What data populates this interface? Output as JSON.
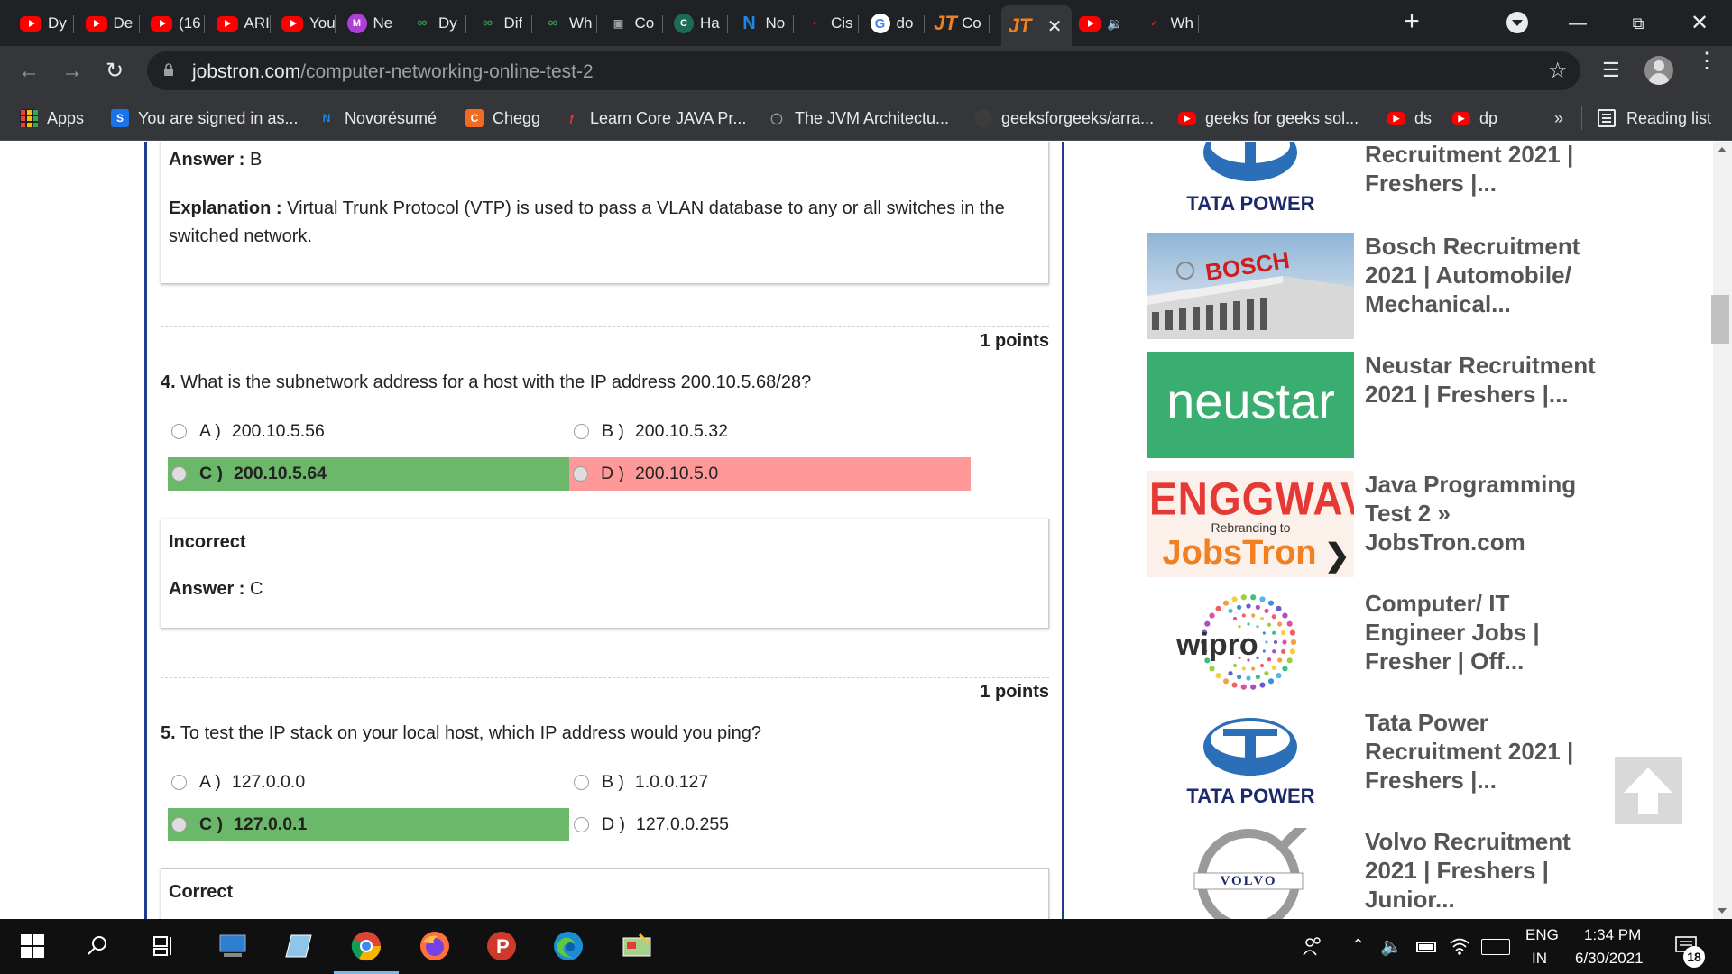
{
  "browser": {
    "tabs": [
      {
        "title": "Dy",
        "icon": "youtube-icon"
      },
      {
        "title": "De",
        "icon": "youtube-icon"
      },
      {
        "title": "(16",
        "icon": "youtube-icon"
      },
      {
        "title": "ARI",
        "icon": "youtube-icon"
      },
      {
        "title": "You",
        "icon": "youtube-icon"
      },
      {
        "title": "Ne",
        "icon": "messenger-icon"
      },
      {
        "title": "Dy",
        "icon": "geeksforgeeks-icon"
      },
      {
        "title": "Dif",
        "icon": "geeksforgeeks-icon"
      },
      {
        "title": "Wh",
        "icon": "geeksforgeeks-icon"
      },
      {
        "title": "Co",
        "icon": "coursera-icon"
      },
      {
        "title": "Ha",
        "icon": "c-icon"
      },
      {
        "title": "No",
        "icon": "novoresume-icon"
      },
      {
        "title": "Cis",
        "icon": "cisco-icon"
      },
      {
        "title": "do",
        "icon": "google-icon"
      },
      {
        "title": "Co",
        "icon": "jobstron-icon"
      },
      {
        "title": "",
        "icon": "jobstron-icon",
        "active": true
      },
      {
        "title": "",
        "icon": "youtube-icon",
        "audio": true
      },
      {
        "title": "Wh",
        "icon": "tutorial-icon"
      }
    ],
    "url_domain": "jobstron.com",
    "url_path": "/computer-networking-online-test-2",
    "bookmarks": [
      {
        "label": "Apps",
        "icon": "apps-grid-icon"
      },
      {
        "label": "You are signed in as...",
        "icon": "s-icon"
      },
      {
        "label": "Novorésumé",
        "icon": "novoresume-icon"
      },
      {
        "label": "Chegg",
        "icon": "chegg-icon"
      },
      {
        "label": "Learn Core JAVA Pr...",
        "icon": "tutorial-icon"
      },
      {
        "label": "The JVM Architectu...",
        "icon": "globe-icon"
      },
      {
        "label": "geeksforgeeks/arra...",
        "icon": "github-icon"
      },
      {
        "label": "geeks for geeks sol...",
        "icon": "youtube-icon"
      },
      {
        "label": "ds",
        "icon": "youtube-icon"
      },
      {
        "label": "dp",
        "icon": "youtube-icon"
      }
    ],
    "overflow": "»",
    "reading_list": "Reading list"
  },
  "quiz": {
    "prev_answer": {
      "label": "Answer :",
      "value": "B"
    },
    "prev_explanation": {
      "label": "Explanation :",
      "text": "Virtual Trunk Protocol (VTP) is used to pass a VLAN database to any or all switches in the switched network."
    },
    "q4": {
      "points": "1 points",
      "number": "4.",
      "text": "What is the subnetwork address for a host with the IP address 200.10.5.68/28?",
      "options": [
        {
          "letter": "A )",
          "text": "200.10.5.56"
        },
        {
          "letter": "B )",
          "text": "200.10.5.32"
        },
        {
          "letter": "C )",
          "text": "200.10.5.64"
        },
        {
          "letter": "D )",
          "text": "200.10.5.0"
        }
      ],
      "result": "Incorrect",
      "answer_label": "Answer :",
      "answer": "C"
    },
    "q5": {
      "points": "1 points",
      "number": "5.",
      "text": "To test the IP stack on your local host, which IP address would you ping?",
      "options": [
        {
          "letter": "A )",
          "text": "127.0.0.0"
        },
        {
          "letter": "B )",
          "text": "1.0.0.127"
        },
        {
          "letter": "C )",
          "text": "127.0.0.1"
        },
        {
          "letter": "D )",
          "text": "127.0.0.255"
        }
      ],
      "result": "Correct"
    },
    "colors": {
      "correct": "#6cb86a",
      "wrong": "#ff9999",
      "frame": "#1f3d8a"
    }
  },
  "sidebar": {
    "items": [
      {
        "title": "Recruitment 2021 | Freshers |...",
        "logo_text": "TATA POWER",
        "logo": "tata-power-logo"
      },
      {
        "title": "Bosch Recruitment 2021 | Automobile/ Mechanical...",
        "logo_text": "BOSCH",
        "logo": "bosch-building-image"
      },
      {
        "title": "Neustar Recruitment 2021 | Freshers |...",
        "logo_text": "neustar",
        "logo": "neustar-logo"
      },
      {
        "title": "Java Programming Test 2 » JobsTron.com",
        "logo_text": "ENGGWAVE",
        "logo_sub": "Rebranding to",
        "logo_text2": "JobsTron",
        "logo": "enggwave-logo"
      },
      {
        "title": "Computer/ IT Engineer Jobs | Fresher | Off...",
        "logo_text": "wipro",
        "logo": "wipro-logo"
      },
      {
        "title": "Tata Power Recruitment 2021 | Freshers |...",
        "logo_text": "TATA POWER",
        "logo": "tata-power-logo"
      },
      {
        "title": "Volvo Recruitment 2021 | Freshers | Junior...",
        "logo_text": "VOLVO",
        "logo": "volvo-logo"
      }
    ]
  },
  "taskbar": {
    "lang_top": "ENG",
    "lang_bottom": "IN",
    "time": "1:34 PM",
    "date": "6/30/2021",
    "notifications": "18"
  }
}
